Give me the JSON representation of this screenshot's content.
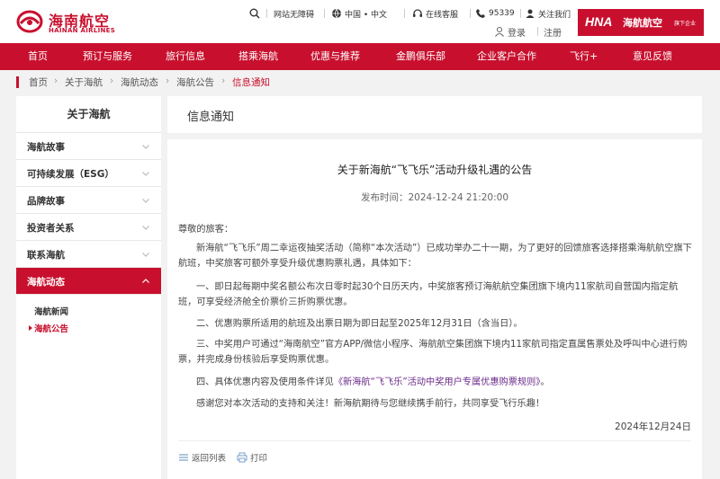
{
  "header": {
    "logo_cn": "海南航空",
    "logo_en": "HAINAN AIRLINES",
    "util": {
      "accessibility": "网站无障碍",
      "region": "中国 • 中文",
      "service": "在线客服",
      "phone": "95339",
      "follow": "关注我们"
    },
    "login": "登录",
    "register": "注册",
    "hna": {
      "word": "HNA",
      "cn": "海航航空",
      "sub": "旗下企业"
    }
  },
  "nav": [
    "首页",
    "预订与服务",
    "旅行信息",
    "搭乘海航",
    "优惠与推荐",
    "金鹏俱乐部",
    "企业客户合作",
    "飞行+",
    "意见反馈"
  ],
  "breadcrumb": [
    "首页",
    "关于海航",
    "海航动态",
    "海航公告",
    "信息通知"
  ],
  "sidebar": {
    "title": "关于海航",
    "items": [
      "海航故事",
      "可持续发展（ESG）",
      "品牌故事",
      "投资者关系",
      "联系海航",
      "海航动态"
    ],
    "sub_items": [
      "海航新闻",
      "海航公告"
    ]
  },
  "content": {
    "section_title": "信息通知",
    "title": "关于新海航“飞飞乐”活动升级礼遇的公告",
    "publish_time": "发布时间：2024-12-24 21:20:00",
    "greeting": "尊敬的旅客：",
    "p1": "新海航“飞飞乐”周二幸运夜抽奖活动（简称“本次活动”）已成功举办二十一期，为了更好的回馈旅客选择搭乘海航航空旗下航班，中奖旅客可额外享受升级优惠购票礼遇，具体如下：",
    "p2": "一、即日起每期中奖名额公布次日零时起30个日历天内，中奖旅客预订海航航空集团旗下境内11家航司自营国内指定航班，可享受经济舱全价票价三折购票优惠。",
    "p3": "二、优惠购票所适用的航班及出票日期为即日起至2025年12月31日（含当日）。",
    "p4": "三、中奖用户可通过“海南航空”官方APP/微信小程序、海航航空集团旗下境内11家航司指定直属售票处及呼叫中心进行购票，并完成身份核验后享受购票优惠。",
    "p5_prefix": "四、具体优惠内容及使用条件详见",
    "p5_link": "《新海航“飞飞乐”活动中奖用户专属优惠购票规则》",
    "p5_suffix": "。",
    "p6": "感谢您对本次活动的支持和关注！新海航期待与您继续携手前行，共同享受飞行乐趣！",
    "sign_date": "2024年12月24日",
    "back": "返回列表",
    "print": "打印"
  },
  "colors": {
    "brand_red": "#c8102e",
    "link_purple": "#6b2a8a"
  },
  "icons": [
    "search-icon",
    "accessibility-icon",
    "globe-icon",
    "headset-icon",
    "phone-icon",
    "user-icon",
    "lock-icon",
    "chevron-down-icon",
    "chevron-up-icon",
    "list-icon",
    "printer-icon"
  ]
}
